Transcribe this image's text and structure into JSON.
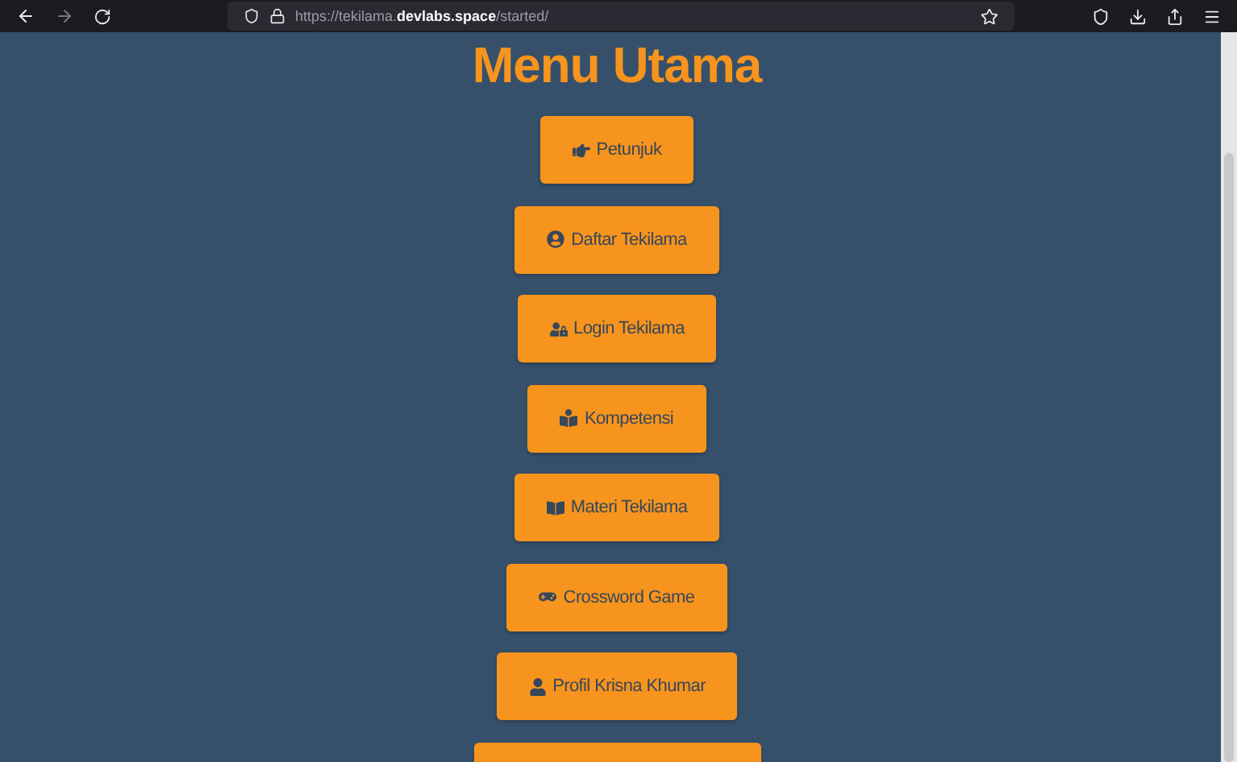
{
  "browser": {
    "url": "https://tekilama.**devlabs.space**/started/"
  },
  "page": {
    "title": "Menu Utama",
    "buttons": [
      {
        "label": "Petunjuk",
        "kind": "hand"
      },
      {
        "label": "Daftar Tekilama",
        "kind": "register"
      },
      {
        "label": "Login Tekilama",
        "kind": "login"
      },
      {
        "label": "Kompetensi",
        "kind": "competence"
      },
      {
        "label": "Materi Tekilama",
        "kind": "material"
      },
      {
        "label": "Crossword Game",
        "kind": "game"
      },
      {
        "label": "Profil Krisna Khumar",
        "kind": "profile"
      }
    ]
  }
}
